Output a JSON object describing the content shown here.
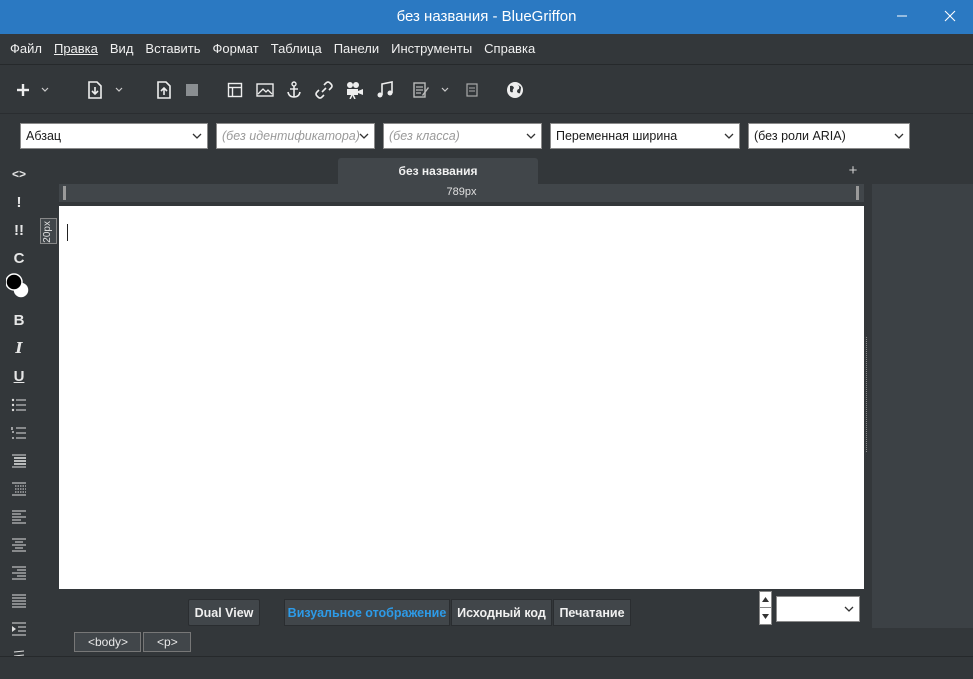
{
  "window": {
    "title": "без названия - BlueGriffon",
    "controls": [
      "minimize-icon",
      "maximize-icon",
      "close-icon"
    ]
  },
  "menu": {
    "items": [
      "Файл",
      "Правка",
      "Вид",
      "Вставить",
      "Формат",
      "Таблица",
      "Панели",
      "Инструменты",
      "Справка"
    ]
  },
  "toolbar": {
    "icons": [
      "plus-icon",
      "new-document-icon",
      "upload-icon",
      "stop-icon",
      "table-icon",
      "image-icon",
      "anchor-icon",
      "link-icon",
      "video-icon",
      "audio-icon",
      "form-icon",
      "note-icon",
      "globe-icon"
    ]
  },
  "format": {
    "paragraph": "Абзац",
    "id_placeholder": "(без идентификатора)",
    "class_placeholder": "(без класса)",
    "width": "Переменная ширина",
    "aria": "(без роли ARIA)"
  },
  "sidebar": {
    "source_label": "<>",
    "important_label": "!",
    "very_important_label": "!!",
    "clear_label": "C",
    "bold_label": "B",
    "italic_label": "I",
    "underline_label": "U"
  },
  "tabs": {
    "active": "без названия",
    "add_label": "+"
  },
  "ruler": {
    "width_label": "789px",
    "height_label": "20px"
  },
  "views": {
    "dual": "Dual View",
    "visual": "Визуальное отображение",
    "source": "Исходный код",
    "print": "Печатание"
  },
  "breadcrumbs": [
    "<body>",
    "<p>"
  ],
  "colors": {
    "titlebar": "#2b79c2",
    "chrome": "#33373a",
    "active_view": "#2d9be8"
  }
}
